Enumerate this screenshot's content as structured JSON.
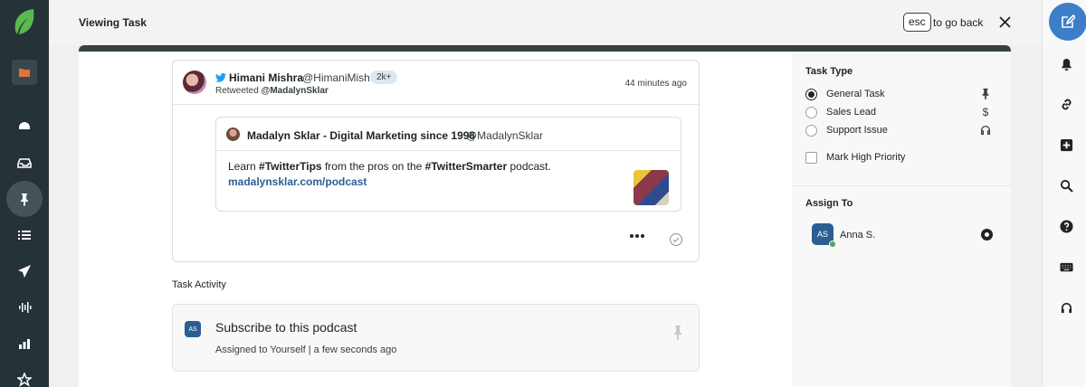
{
  "header": {
    "title": "Viewing Task",
    "esc_key": "esc",
    "go_back": "to go back"
  },
  "tweet": {
    "author_name": "Himani Mishra",
    "author_handle": "@HimaniMish",
    "follower_badge": "2k+",
    "retweeted_prefix": "Retweeted",
    "retweeted_by": "@MadalynSklar",
    "timestamp": "44 minutes ago",
    "quote": {
      "name": "Madalyn Sklar - Digital Marketing since 1996",
      "handle": "@MadalynSklar",
      "text_1": "Learn ",
      "text_2": "#TwitterTips",
      "text_3": " from the pros on the ",
      "text_4": "#TwitterSmarter",
      "text_5": " podcast.",
      "link": "madalynsklar.com/podcast"
    }
  },
  "activity": {
    "title": "Task Activity",
    "avatar": "AS",
    "item_title": "Subscribe to this podcast",
    "item_meta": "Assigned to Yourself | a few seconds ago"
  },
  "task_type": {
    "title": "Task Type",
    "options": [
      {
        "label": "General Task",
        "icon": "pin-icon",
        "selected": true
      },
      {
        "label": "Sales Lead",
        "icon": "dollar-icon",
        "selected": false
      },
      {
        "label": "Support Issue",
        "icon": "headset-icon",
        "selected": false
      }
    ],
    "priority_label": "Mark High Priority"
  },
  "assign": {
    "title": "Assign To",
    "avatar": "AS",
    "name": "Anna S."
  },
  "colors": {
    "accent": "#3d7ec9",
    "nav_bg": "#253238",
    "link": "#2b5f93",
    "online": "#4fa55b"
  }
}
